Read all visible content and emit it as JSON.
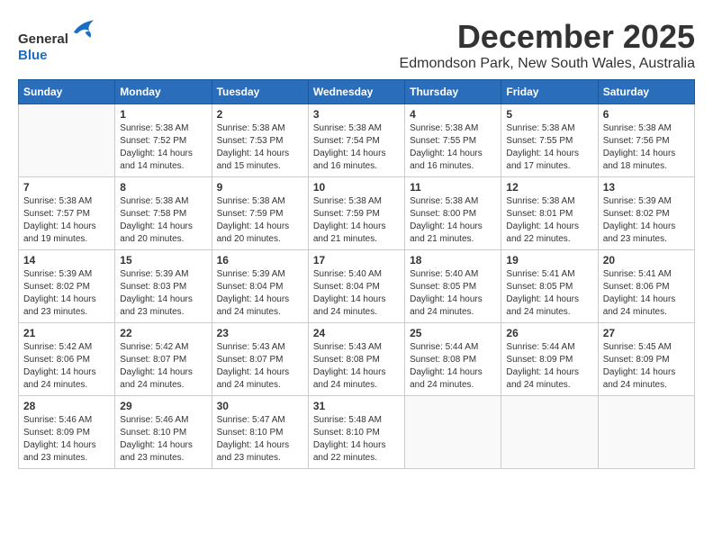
{
  "logo": {
    "general": "General",
    "blue": "Blue"
  },
  "title": "December 2025",
  "location": "Edmondson Park, New South Wales, Australia",
  "days_of_week": [
    "Sunday",
    "Monday",
    "Tuesday",
    "Wednesday",
    "Thursday",
    "Friday",
    "Saturday"
  ],
  "weeks": [
    [
      {
        "day": "",
        "sunrise": "",
        "sunset": "",
        "daylight": ""
      },
      {
        "day": "1",
        "sunrise": "Sunrise: 5:38 AM",
        "sunset": "Sunset: 7:52 PM",
        "daylight": "Daylight: 14 hours and 14 minutes."
      },
      {
        "day": "2",
        "sunrise": "Sunrise: 5:38 AM",
        "sunset": "Sunset: 7:53 PM",
        "daylight": "Daylight: 14 hours and 15 minutes."
      },
      {
        "day": "3",
        "sunrise": "Sunrise: 5:38 AM",
        "sunset": "Sunset: 7:54 PM",
        "daylight": "Daylight: 14 hours and 16 minutes."
      },
      {
        "day": "4",
        "sunrise": "Sunrise: 5:38 AM",
        "sunset": "Sunset: 7:55 PM",
        "daylight": "Daylight: 14 hours and 16 minutes."
      },
      {
        "day": "5",
        "sunrise": "Sunrise: 5:38 AM",
        "sunset": "Sunset: 7:55 PM",
        "daylight": "Daylight: 14 hours and 17 minutes."
      },
      {
        "day": "6",
        "sunrise": "Sunrise: 5:38 AM",
        "sunset": "Sunset: 7:56 PM",
        "daylight": "Daylight: 14 hours and 18 minutes."
      }
    ],
    [
      {
        "day": "7",
        "sunrise": "Sunrise: 5:38 AM",
        "sunset": "Sunset: 7:57 PM",
        "daylight": "Daylight: 14 hours and 19 minutes."
      },
      {
        "day": "8",
        "sunrise": "Sunrise: 5:38 AM",
        "sunset": "Sunset: 7:58 PM",
        "daylight": "Daylight: 14 hours and 20 minutes."
      },
      {
        "day": "9",
        "sunrise": "Sunrise: 5:38 AM",
        "sunset": "Sunset: 7:59 PM",
        "daylight": "Daylight: 14 hours and 20 minutes."
      },
      {
        "day": "10",
        "sunrise": "Sunrise: 5:38 AM",
        "sunset": "Sunset: 7:59 PM",
        "daylight": "Daylight: 14 hours and 21 minutes."
      },
      {
        "day": "11",
        "sunrise": "Sunrise: 5:38 AM",
        "sunset": "Sunset: 8:00 PM",
        "daylight": "Daylight: 14 hours and 21 minutes."
      },
      {
        "day": "12",
        "sunrise": "Sunrise: 5:38 AM",
        "sunset": "Sunset: 8:01 PM",
        "daylight": "Daylight: 14 hours and 22 minutes."
      },
      {
        "day": "13",
        "sunrise": "Sunrise: 5:39 AM",
        "sunset": "Sunset: 8:02 PM",
        "daylight": "Daylight: 14 hours and 23 minutes."
      }
    ],
    [
      {
        "day": "14",
        "sunrise": "Sunrise: 5:39 AM",
        "sunset": "Sunset: 8:02 PM",
        "daylight": "Daylight: 14 hours and 23 minutes."
      },
      {
        "day": "15",
        "sunrise": "Sunrise: 5:39 AM",
        "sunset": "Sunset: 8:03 PM",
        "daylight": "Daylight: 14 hours and 23 minutes."
      },
      {
        "day": "16",
        "sunrise": "Sunrise: 5:39 AM",
        "sunset": "Sunset: 8:04 PM",
        "daylight": "Daylight: 14 hours and 24 minutes."
      },
      {
        "day": "17",
        "sunrise": "Sunrise: 5:40 AM",
        "sunset": "Sunset: 8:04 PM",
        "daylight": "Daylight: 14 hours and 24 minutes."
      },
      {
        "day": "18",
        "sunrise": "Sunrise: 5:40 AM",
        "sunset": "Sunset: 8:05 PM",
        "daylight": "Daylight: 14 hours and 24 minutes."
      },
      {
        "day": "19",
        "sunrise": "Sunrise: 5:41 AM",
        "sunset": "Sunset: 8:05 PM",
        "daylight": "Daylight: 14 hours and 24 minutes."
      },
      {
        "day": "20",
        "sunrise": "Sunrise: 5:41 AM",
        "sunset": "Sunset: 8:06 PM",
        "daylight": "Daylight: 14 hours and 24 minutes."
      }
    ],
    [
      {
        "day": "21",
        "sunrise": "Sunrise: 5:42 AM",
        "sunset": "Sunset: 8:06 PM",
        "daylight": "Daylight: 14 hours and 24 minutes."
      },
      {
        "day": "22",
        "sunrise": "Sunrise: 5:42 AM",
        "sunset": "Sunset: 8:07 PM",
        "daylight": "Daylight: 14 hours and 24 minutes."
      },
      {
        "day": "23",
        "sunrise": "Sunrise: 5:43 AM",
        "sunset": "Sunset: 8:07 PM",
        "daylight": "Daylight: 14 hours and 24 minutes."
      },
      {
        "day": "24",
        "sunrise": "Sunrise: 5:43 AM",
        "sunset": "Sunset: 8:08 PM",
        "daylight": "Daylight: 14 hours and 24 minutes."
      },
      {
        "day": "25",
        "sunrise": "Sunrise: 5:44 AM",
        "sunset": "Sunset: 8:08 PM",
        "daylight": "Daylight: 14 hours and 24 minutes."
      },
      {
        "day": "26",
        "sunrise": "Sunrise: 5:44 AM",
        "sunset": "Sunset: 8:09 PM",
        "daylight": "Daylight: 14 hours and 24 minutes."
      },
      {
        "day": "27",
        "sunrise": "Sunrise: 5:45 AM",
        "sunset": "Sunset: 8:09 PM",
        "daylight": "Daylight: 14 hours and 24 minutes."
      }
    ],
    [
      {
        "day": "28",
        "sunrise": "Sunrise: 5:46 AM",
        "sunset": "Sunset: 8:09 PM",
        "daylight": "Daylight: 14 hours and 23 minutes."
      },
      {
        "day": "29",
        "sunrise": "Sunrise: 5:46 AM",
        "sunset": "Sunset: 8:10 PM",
        "daylight": "Daylight: 14 hours and 23 minutes."
      },
      {
        "day": "30",
        "sunrise": "Sunrise: 5:47 AM",
        "sunset": "Sunset: 8:10 PM",
        "daylight": "Daylight: 14 hours and 23 minutes."
      },
      {
        "day": "31",
        "sunrise": "Sunrise: 5:48 AM",
        "sunset": "Sunset: 8:10 PM",
        "daylight": "Daylight: 14 hours and 22 minutes."
      },
      {
        "day": "",
        "sunrise": "",
        "sunset": "",
        "daylight": ""
      },
      {
        "day": "",
        "sunrise": "",
        "sunset": "",
        "daylight": ""
      },
      {
        "day": "",
        "sunrise": "",
        "sunset": "",
        "daylight": ""
      }
    ]
  ]
}
